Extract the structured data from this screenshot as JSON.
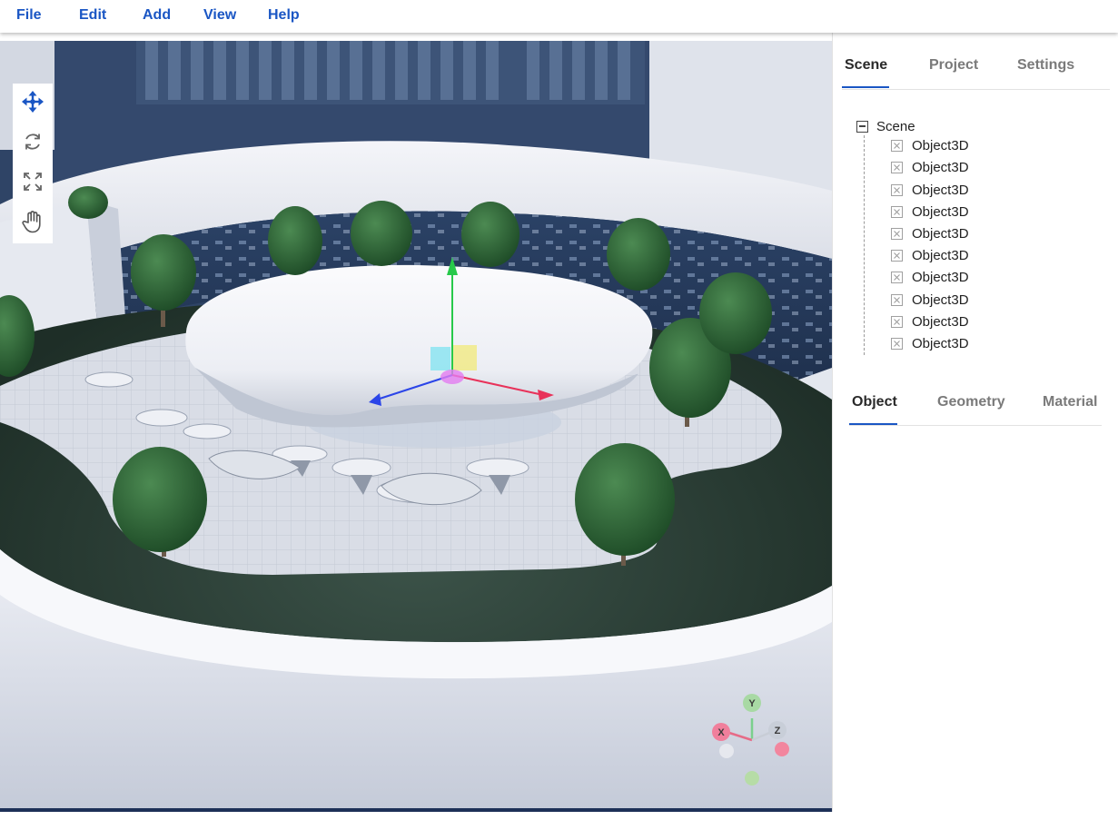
{
  "menu": {
    "items": [
      {
        "label": "File"
      },
      {
        "label": "Edit"
      },
      {
        "label": "Add"
      },
      {
        "label": "View"
      },
      {
        "label": "Help"
      }
    ]
  },
  "toolbar": {
    "tools": [
      {
        "icon": "move-icon",
        "active": true
      },
      {
        "icon": "rotate-icon",
        "active": false
      },
      {
        "icon": "scale-icon",
        "active": false
      },
      {
        "icon": "pan-hand-icon",
        "active": false
      }
    ]
  },
  "sidebar": {
    "top_tabs": [
      {
        "label": "Scene",
        "active": true
      },
      {
        "label": "Project",
        "active": false
      },
      {
        "label": "Settings",
        "active": false
      }
    ],
    "tree": {
      "root": {
        "label": "Scene",
        "expanded": true
      },
      "children": [
        {
          "label": "Object3D"
        },
        {
          "label": "Object3D"
        },
        {
          "label": "Object3D"
        },
        {
          "label": "Object3D"
        },
        {
          "label": "Object3D"
        },
        {
          "label": "Object3D"
        },
        {
          "label": "Object3D"
        },
        {
          "label": "Object3D"
        },
        {
          "label": "Object3D"
        },
        {
          "label": "Object3D"
        }
      ]
    },
    "bottom_tabs": [
      {
        "label": "Object",
        "active": true
      },
      {
        "label": "Geometry",
        "active": false
      },
      {
        "label": "Material",
        "active": false
      }
    ]
  },
  "gizmo": {
    "labels": {
      "x": "X",
      "y": "Y",
      "z": "Z"
    }
  },
  "colors": {
    "accent": "#1a56c4",
    "axis_x": "#e8325a",
    "axis_y": "#27c94a",
    "axis_z": "#2b45e8"
  }
}
